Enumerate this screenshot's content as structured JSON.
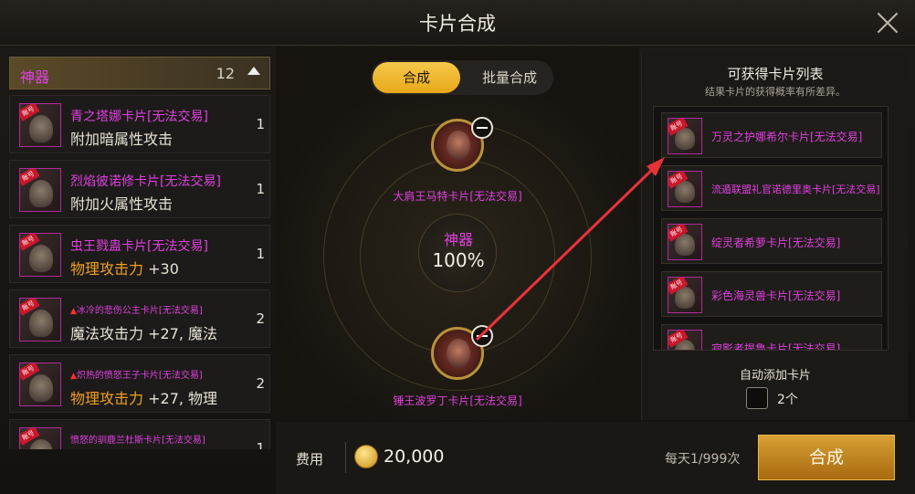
{
  "title": "卡片合成",
  "category": {
    "name": "神器",
    "count": "12"
  },
  "cards": [
    {
      "name": "青之塔娜卡片[无法交易]",
      "desc": "附加暗属性攻击",
      "count": "1"
    },
    {
      "name": "烈焰彼诺修卡片[无法交易]",
      "desc": "附加火属性攻击",
      "count": "1"
    },
    {
      "name": "虫王戮蛊卡片[无法交易]",
      "desc_label": "物理攻击力",
      "desc_value": " +30",
      "count": "1"
    },
    {
      "warn": "▲",
      "name": "冰冷的悲伤公主卡片[无法交易]",
      "desc": "魔法攻击力 +27, 魔法",
      "count": "2"
    },
    {
      "warn": "▲",
      "name": "炽热的愤怒王子卡片[无法交易]",
      "desc_label": "物理攻击力",
      "desc_value": " +27, 物理",
      "count": "2"
    },
    {
      "name": "愤怒的驯鹿兰杜斯卡片[无法交易]",
      "count": "1"
    }
  ],
  "tabs": {
    "active": "合成",
    "other": "批量合成"
  },
  "slots": [
    {
      "label": "大肩王马特卡片[无法交易]"
    },
    {
      "label": "锤王波罗丁卡片[无法交易]"
    }
  ],
  "center": {
    "title": "神器",
    "percent": "100%"
  },
  "results": {
    "title": "可获得卡片列表",
    "subtitle": "结果卡片的获得概率有所差异。",
    "items": [
      "万灵之护娜希尔卡片[无法交易]",
      "流遁联盟礼官诺德里奥卡片[无法交易]",
      "绽灵者希萝卡片[无法交易]",
      "彩色海灵兽卡片[无法交易]",
      "寂影者提鲁卡片[无法交易]"
    ],
    "auto_label": "自动添加卡片",
    "auto_count": "2个"
  },
  "footer": {
    "fee_label": "费用",
    "fee_value": "20,000",
    "daily": "每天1/999次",
    "synth_button": "合成"
  },
  "colors": {
    "accent": "#e040e0",
    "button": "#d8a034",
    "arrow": "#e8323a"
  }
}
